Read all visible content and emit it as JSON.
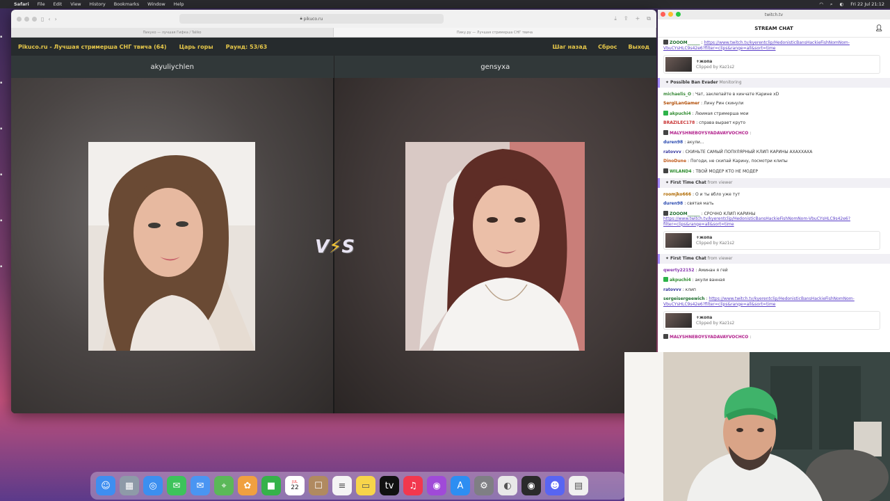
{
  "menubar": {
    "app": "Safari",
    "items": [
      "File",
      "Edit",
      "View",
      "History",
      "Bookmarks",
      "Window",
      "Help"
    ],
    "clock": "Fri 22 Jul 21:12"
  },
  "safari": {
    "url": "pikuco.ru",
    "tabs": [
      "Пикуко — лучшая Гифка / Taliko",
      "Пику.ру — Лучшая стримерша СНГ твича"
    ]
  },
  "site": {
    "title": "Pikuco.ru - Лучшая стримерша СНГ твича (64)",
    "mode": "Царь горы",
    "round": "Раунд: 53/63",
    "back": "Шаг назад",
    "reset": "Сброс",
    "exit": "Выход"
  },
  "contestants": {
    "left": "akyuliychlen",
    "right": "gensyxa"
  },
  "vs": {
    "v": "V",
    "s": "S"
  },
  "chat": {
    "window_title": "twitch.tv",
    "header": "STREAM CHAT",
    "messages": [
      {
        "user": "ZOOOM______",
        "color": "#1e6e2e",
        "badge": "dark",
        "text": "",
        "link": "https://www.twitch.tv/kyerentclip/HedonisticBansHackieFishNomNom-VbuCYsHLC9s42e6?filter=clips&range=all&sort=time"
      },
      {
        "clip": true,
        "title": "+жопа",
        "by": "Clipped by Kaz1s2"
      },
      {
        "notice": true,
        "title": "Possible Ban Evader",
        "sub": "Monitoring"
      },
      {
        "user": "michaelis_O",
        "color": "#3a8a3a",
        "text": "Чат, заклепайте в кинчате Карине xD"
      },
      {
        "user": "SergiLanGamer",
        "color": "#b04a00",
        "text": "Лину Рин скинули"
      },
      {
        "user": "akpuchi4",
        "color": "#2d8a2d",
        "badge": "green",
        "text": "Люимая стримерша мои"
      },
      {
        "user": "BRAZILEC178",
        "color": "#c83232",
        "text": "справа вырает круто"
      },
      {
        "user": "MALYSHNEBOYSYADAVAYVOCHCO",
        "color": "#b01c8a",
        "badge": "dark",
        "text": ""
      },
      {
        "user": "duren98",
        "color": "#2a4ab0",
        "text": "акули..."
      },
      {
        "user": "ratovvv",
        "color": "#3a3aa0",
        "text": "СКИНЬТЕ САМЫЙ ПОПУЛЯРНЫЙ КЛИП КАРИНЫ АХАХХАХА"
      },
      {
        "user": "DinoDune",
        "color": "#c05a1a",
        "text": "Погоди, не скипай Карину, посмотри клипы"
      },
      {
        "user": "WILAND4",
        "color": "#2a8a2a",
        "badge": "dark",
        "text": "ТВОЙ МОДЕР КТО НЕ МОДЕР"
      },
      {
        "notice": true,
        "title": "First Time Chat",
        "sub": "from viewer"
      },
      {
        "user": "roomjko666",
        "color": "#b06a00",
        "text": "О и ты вбло уже тут"
      },
      {
        "user": "duren98",
        "color": "#2a4ab0",
        "text": "святая мать"
      },
      {
        "user": "ZOOOM______",
        "color": "#1e6e2e",
        "badge": "dark",
        "text": "СРОЧНО КЛИП КАРИНЫ",
        "link": "https://www.twitch.tv/kyerentclip/HedonisticBansHackieFishNomNom-VbuCYsHLC9s42e6?filter=clips&range=all&sort=time"
      },
      {
        "clip": true,
        "title": "+жопа",
        "by": "Clipped by Kaz1s2"
      },
      {
        "notice": true,
        "title": "First Time Chat",
        "sub": "from viewer"
      },
      {
        "user": "qwerty22152",
        "color": "#8a3ab0",
        "text": "Аминан я гей"
      },
      {
        "user": "akpuchi4",
        "color": "#2d8a2d",
        "badge": "green",
        "text": "акули ванная"
      },
      {
        "user": "ratovvv",
        "color": "#3a3aa0",
        "text": "клип"
      },
      {
        "user": "sergeisergeewich",
        "color": "#1e6e2e",
        "text": "",
        "link": "https://www.twitch.tv/kyerentclip/HedonisticBansHackieFishNomNom-VbuCYsHLC9s42e6?filter=clips&range=all&sort=time"
      },
      {
        "clip": true,
        "title": "+жопа",
        "by": "Clipped by Kaz1s2"
      },
      {
        "user": "MALYSHNEBOYSYADAVAYVOCHCO",
        "color": "#b01c8a",
        "badge": "dark",
        "text": ""
      }
    ]
  },
  "dock": {
    "calendar_month": "JUL",
    "calendar_day": "22",
    "icons": [
      {
        "name": "finder-icon",
        "color": "#3f8ef0",
        "glyph": "☺"
      },
      {
        "name": "launchpad-icon",
        "color": "#8e9aa8",
        "glyph": "▦"
      },
      {
        "name": "safari-icon",
        "color": "#3c8ff0",
        "glyph": "◎"
      },
      {
        "name": "messages-icon",
        "color": "#3dc35b",
        "glyph": "✉"
      },
      {
        "name": "mail-icon",
        "color": "#4a95f2",
        "glyph": "✉"
      },
      {
        "name": "maps-icon",
        "color": "#5bb858",
        "glyph": "⌖"
      },
      {
        "name": "photos-icon",
        "color": "#f0a040",
        "glyph": "✿"
      },
      {
        "name": "facetime-icon",
        "color": "#36b24a",
        "glyph": "■"
      },
      {
        "name": "calendar-icon",
        "color": "#ffffff",
        "glyph": "22"
      },
      {
        "name": "contacts-icon",
        "color": "#b08a60",
        "glyph": "☐"
      },
      {
        "name": "reminders-icon",
        "color": "#f4f4f4",
        "glyph": "≡"
      },
      {
        "name": "notes-icon",
        "color": "#f7d44a",
        "glyph": "▭"
      },
      {
        "name": "appletv-icon",
        "color": "#111111",
        "glyph": "tv"
      },
      {
        "name": "music-icon",
        "color": "#f2384e",
        "glyph": "♫"
      },
      {
        "name": "podcasts-icon",
        "color": "#a04ad8",
        "glyph": "◉"
      },
      {
        "name": "appstore-icon",
        "color": "#2d8ef2",
        "glyph": "A"
      },
      {
        "name": "settings-icon",
        "color": "#7f7f84",
        "glyph": "⚙"
      },
      {
        "name": "chrome-icon",
        "color": "#e8e8e8",
        "glyph": "◐"
      },
      {
        "name": "obs-icon",
        "color": "#2a2a2a",
        "glyph": "◉"
      },
      {
        "name": "discord-icon",
        "color": "#5865f2",
        "glyph": "☻"
      },
      {
        "name": "document-icon",
        "color": "#f0f0f0",
        "glyph": "▤"
      }
    ]
  }
}
